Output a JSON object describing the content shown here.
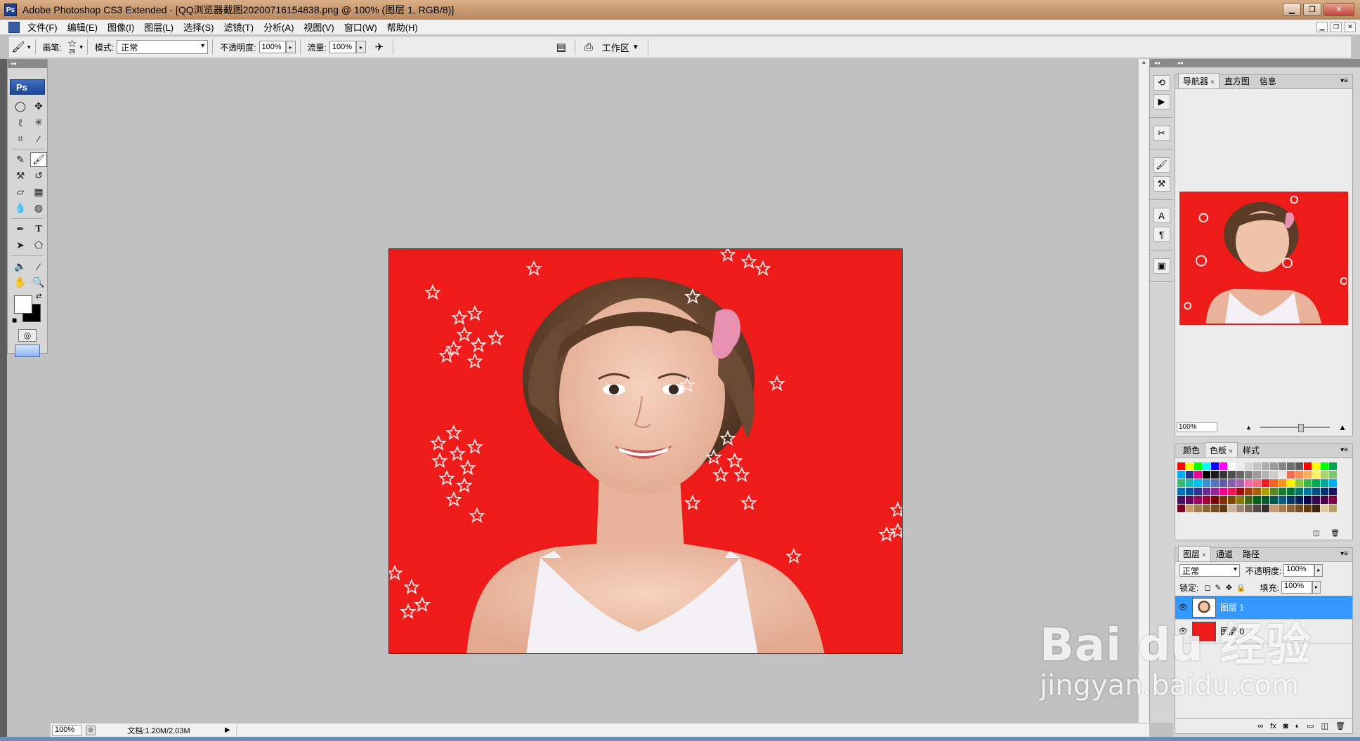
{
  "window": {
    "app_icon": "Ps",
    "title": "Adobe Photoshop CS3 Extended - [QQ浏览器截图20200716154838.png @ 100% (图层 1, RGB/8)]",
    "controls": [
      "minimize-icon",
      "restore-icon",
      "close-icon"
    ]
  },
  "menu": {
    "items": [
      "文件(F)",
      "编辑(E)",
      "图像(I)",
      "图层(L)",
      "选择(S)",
      "滤镜(T)",
      "分析(A)",
      "视图(V)",
      "窗口(W)",
      "帮助(H)"
    ]
  },
  "options": {
    "brush_label": "画笔:",
    "brush_size": "29",
    "mode_label": "模式:",
    "mode_value": "正常",
    "opacity_label": "不透明度:",
    "opacity_value": "100%",
    "flow_label": "流量:",
    "flow_value": "100%",
    "workspace_label": "工作区"
  },
  "toolbox": {
    "badge": "Ps"
  },
  "status": {
    "zoom": "100%",
    "doc": "文档:1.20M/2.03M"
  },
  "panels": {
    "navigator": {
      "tabs": [
        "导航器",
        "直方图",
        "信息"
      ],
      "zoom": "100%"
    },
    "swatches": {
      "tabs": [
        "颜色",
        "色板",
        "样式"
      ],
      "colors": [
        "#ff0000",
        "#ffff00",
        "#00ff00",
        "#00ffff",
        "#0000ff",
        "#ff00ff",
        "#ffffff",
        "#ebebeb",
        "#d6d6d6",
        "#c2c2c2",
        "#adadad",
        "#999999",
        "#858585",
        "#707070",
        "#5c5c5c",
        "#ff0000",
        "#ffff00",
        "#00ff00",
        "#00a651",
        "#00aeef",
        "#2e3192",
        "#ec008c",
        "#000000",
        "#1a1a1a",
        "#333333",
        "#4d4d4d",
        "#666666",
        "#808080",
        "#999999",
        "#b3b3b3",
        "#cccccc",
        "#e6e6e6",
        "#f26c4f",
        "#f68e55",
        "#fbaf5d",
        "#fff467",
        "#acd372",
        "#7cc576",
        "#3bb878",
        "#1abbb4",
        "#00bff3",
        "#438ccb",
        "#5574b9",
        "#605ca8",
        "#855fa8",
        "#a763a8",
        "#f06ea9",
        "#f26d7d",
        "#ed1c24",
        "#f26522",
        "#f7941d",
        "#fff200",
        "#8dc63f",
        "#39b54a",
        "#00a651",
        "#00a99d",
        "#00aeef",
        "#0072bc",
        "#0054a6",
        "#2e3192",
        "#662d91",
        "#92278f",
        "#ec008c",
        "#ed145b",
        "#9e0b0f",
        "#a0410d",
        "#a36209",
        "#aba000",
        "#598527",
        "#197b30",
        "#007236",
        "#00746b",
        "#0076a3",
        "#004b80",
        "#003471",
        "#1b1464",
        "#440e62",
        "#630460",
        "#9e005d",
        "#9e0039",
        "#790000",
        "#7b2e00",
        "#7d4900",
        "#827b00",
        "#406618",
        "#005e20",
        "#005826",
        "#005952",
        "#005b7f",
        "#003663",
        "#002157",
        "#0d004c",
        "#32004b",
        "#4b0049",
        "#7b0046",
        "#7a0026",
        "#c69c6e",
        "#a67c52",
        "#8c6239",
        "#754c24",
        "#603913",
        "#c7b299",
        "#998675",
        "#736357",
        "#534741",
        "#362f2d",
        "#c69c6e",
        "#a67c52",
        "#8c6239",
        "#754c24",
        "#603913",
        "#3c2415",
        "#e0c8a0",
        "#b89c6c"
      ]
    },
    "layers": {
      "tabs": [
        "图层",
        "通道",
        "路径"
      ],
      "blend_mode": "正常",
      "opacity_label": "不透明度:",
      "opacity_value": "100%",
      "lock_label": "锁定:",
      "fill_label": "填充:",
      "fill_value": "100%",
      "items": [
        {
          "name": "图层 1",
          "selected": true
        },
        {
          "name": "图层 0",
          "selected": false
        }
      ]
    }
  },
  "watermark": {
    "main": "Bai du 经验",
    "url": "jingyan.baidu.com"
  }
}
